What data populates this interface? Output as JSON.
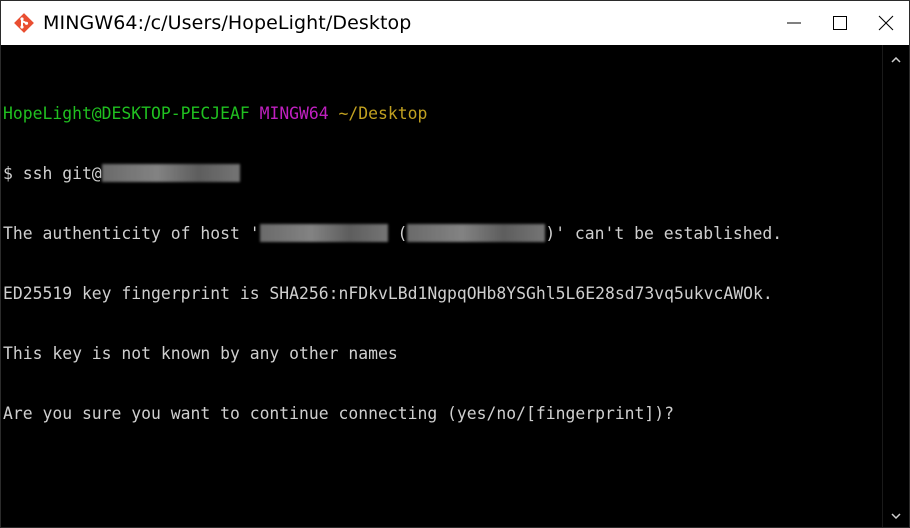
{
  "window": {
    "title": "MINGW64:/c/Users/HopeLight/Desktop",
    "app_icon": "git-diamond-icon",
    "controls": {
      "minimize_icon": "minimize-icon",
      "maximize_icon": "maximize-icon",
      "close_icon": "close-icon"
    }
  },
  "terminal": {
    "prompt": {
      "user_host": "HopeLight@DESKTOP-PECJEAF",
      "env": "MINGW64",
      "path": "~/Desktop"
    },
    "command": "$ ssh git@",
    "host_line_prefix": "The authenticity of host '",
    "host_line_middle": " (",
    "host_line_suffix": ")' can't be established.",
    "fingerprint_line": "ED25519 key fingerprint is SHA256:nFDkvLBd1NgpqOHb8YSGhl5L6E28sd73vq5ukvcAWOk.",
    "unknown_line": "This key is not known by any other names",
    "confirm_line": "Are you sure you want to continue connecting (yes/no/[fingerprint])?"
  },
  "colors": {
    "prompt_user": "#20c020",
    "prompt_env": "#c020c0",
    "prompt_path": "#c0a020",
    "text": "#cfcfcf",
    "background": "#000000"
  },
  "scrollbar": {
    "up_icon": "scroll-up-arrow-icon",
    "down_icon": "scroll-down-arrow-icon"
  }
}
